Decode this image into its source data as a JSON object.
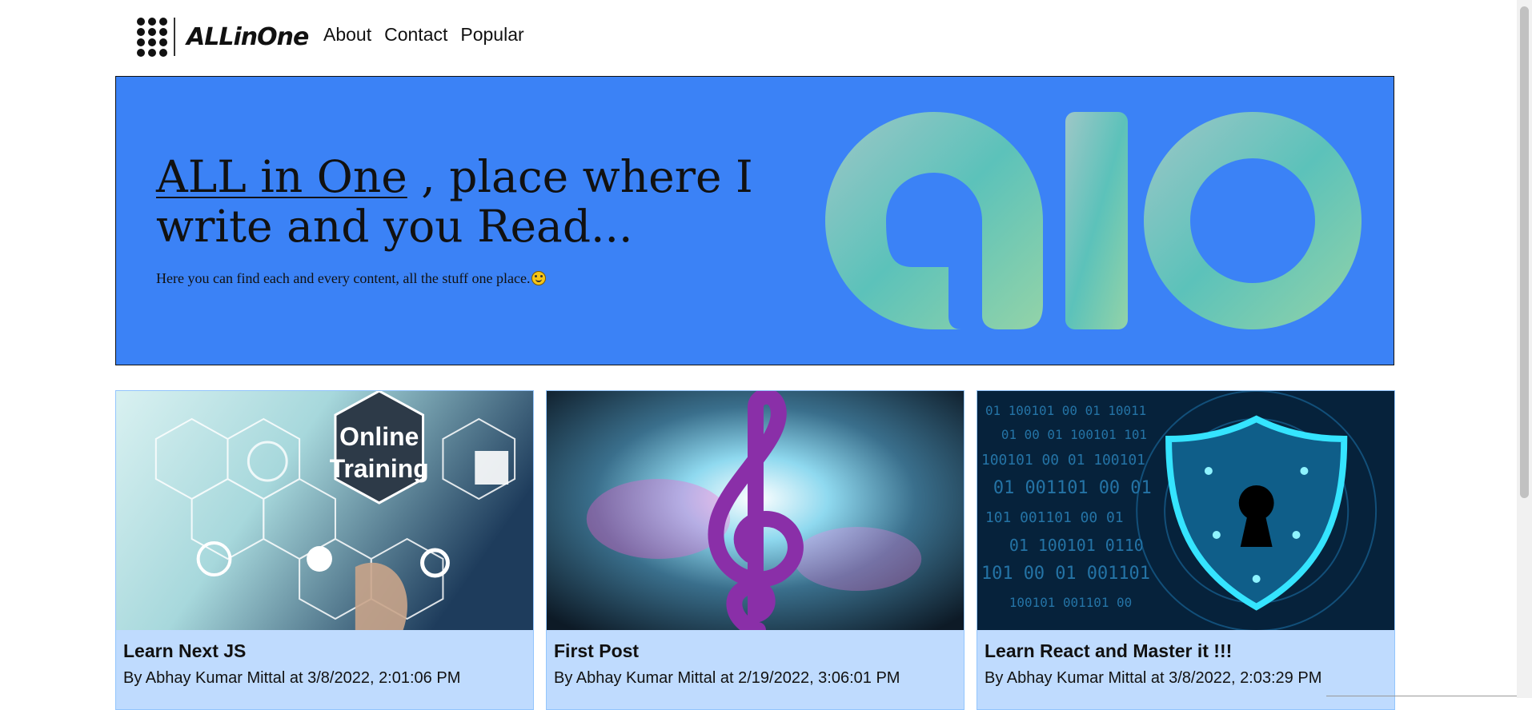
{
  "header": {
    "logo_icon": "grid-dots-icon",
    "logo_text": "ALLinOne",
    "nav": [
      "About",
      "Contact",
      "Popular"
    ]
  },
  "hero": {
    "title_link": "ALL in One",
    "title_rest": " , place where I write and you Read...",
    "subtitle": "Here you can find each and every content, all the stuff one place.",
    "subtitle_emoji": "smiling-face-icon",
    "graphic": "alo",
    "background": "#3b82f6"
  },
  "cards": [
    {
      "title": "Learn Next JS",
      "meta": "By Abhay Kumar Mittal at 3/8/2022, 2:01:06 PM",
      "image": "online-training-image"
    },
    {
      "title": "First Post",
      "meta": "By Abhay Kumar Mittal at 2/19/2022, 3:06:01 PM",
      "image": "treble-clef-image"
    },
    {
      "title": "Learn React and Master it !!!",
      "meta": "By Abhay Kumar Mittal at 3/8/2022, 2:03:29 PM",
      "image": "security-shield-image"
    }
  ],
  "colors": {
    "card_bg": "#bfdbfe",
    "hero_bg": "#3b82f6",
    "graphic": "#7fcfb0"
  }
}
